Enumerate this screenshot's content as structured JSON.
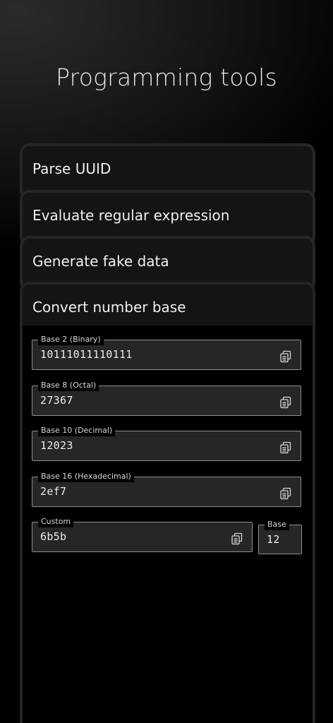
{
  "page": {
    "title": "Programming tools"
  },
  "tools": [
    {
      "label": "Parse UUID"
    },
    {
      "label": "Evaluate regular expression"
    },
    {
      "label": "Generate fake data"
    },
    {
      "label": "Convert number base"
    }
  ],
  "converter": {
    "base2": {
      "label": "Base 2 (Binary)",
      "value": "10111011110111"
    },
    "base8": {
      "label": "Base 8 (Octal)",
      "value": "27367"
    },
    "base10": {
      "label": "Base 10 (Decimal)",
      "value": "12023"
    },
    "base16": {
      "label": "Base 16 (Hexadecimal)",
      "value": "2ef7"
    },
    "custom": {
      "label": "Custom",
      "value": "6b5b"
    },
    "base": {
      "label": "Base",
      "value": "12"
    }
  },
  "icons": {
    "copy": "copy-icon"
  },
  "colors": {
    "background": "#000000",
    "card": "#141414",
    "field": "#262626",
    "border": "#8f8f8f",
    "text": "#ececec"
  }
}
